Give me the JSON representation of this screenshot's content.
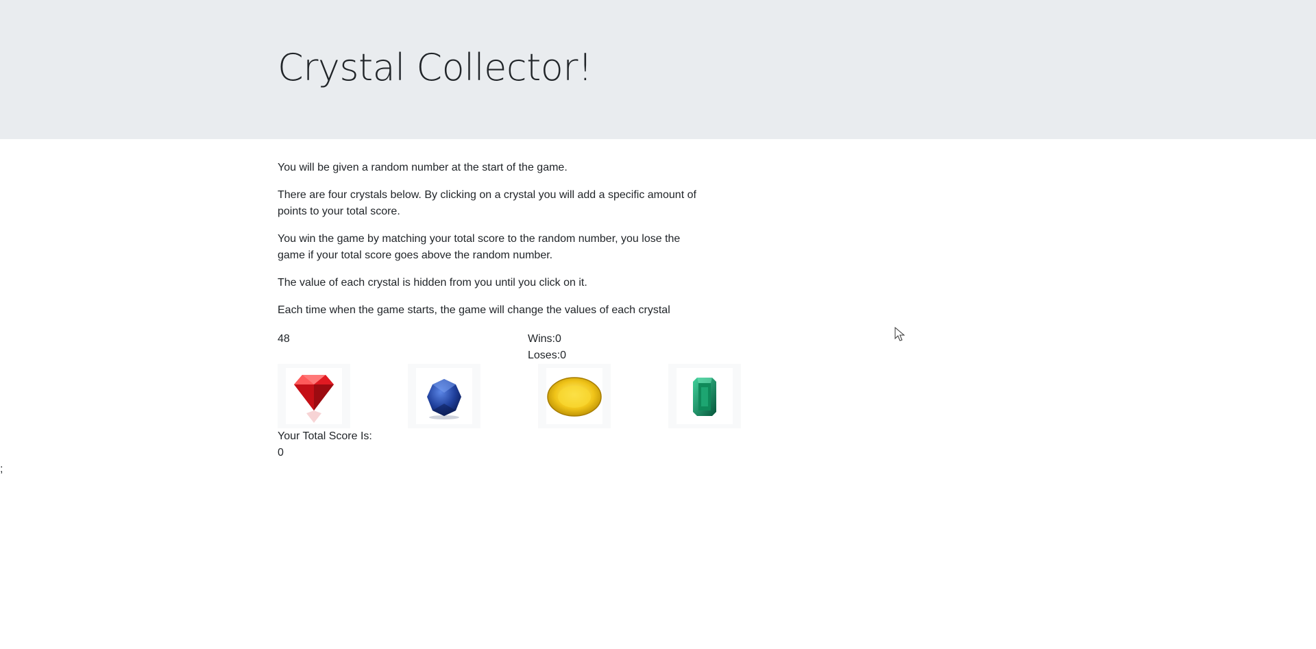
{
  "header": {
    "title": "Crystal Collector!"
  },
  "instructions": [
    "You will be given a random number at the start of the game.",
    "There are four crystals below. By clicking on a crystal you will add a specific amount of points to your total score.",
    "You win the game by matching your total score to the random number, you lose the game if your total score goes above the random number.",
    "The value of each crystal is hidden from you until you click on it.",
    "Each time when the game starts, the game will change the values of each crystal"
  ],
  "game": {
    "target_number": "48",
    "wins_label": "Wins:",
    "wins_value": "0",
    "loses_label": "Loses:",
    "loses_value": "0",
    "score_label": "Your Total Score Is:",
    "score_value": "0",
    "stray_text": ";"
  },
  "crystals": [
    {
      "name": "ruby-crystal-icon",
      "color": "#d4141c"
    },
    {
      "name": "sapphire-crystal-icon",
      "color": "#1f3f9b"
    },
    {
      "name": "topaz-crystal-icon",
      "color": "#f0c419"
    },
    {
      "name": "emerald-crystal-icon",
      "color": "#0f8a5a"
    }
  ],
  "colors": {
    "jumbotron_bg": "#e9ecef",
    "text": "#212529"
  }
}
